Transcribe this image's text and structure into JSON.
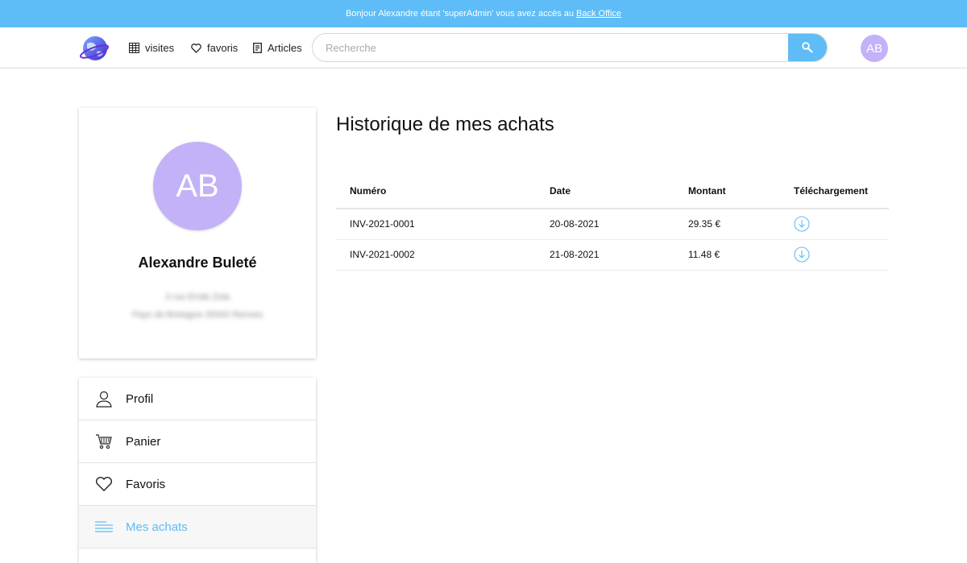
{
  "banner": {
    "text": "Bonjour Alexandre étant 'superAdmin' vous avez accès au",
    "link": "Back Office"
  },
  "header": {
    "nav": [
      {
        "label": "visites",
        "icon": "calendar-grid-icon"
      },
      {
        "label": "favoris",
        "icon": "heart-icon"
      },
      {
        "label": "Articles",
        "icon": "document-icon"
      }
    ],
    "search": {
      "placeholder": "Recherche",
      "value": ""
    },
    "avatar_initials": "AB"
  },
  "profile": {
    "initials": "AB",
    "name": "Alexandre Buleté",
    "address_line1": "3 rue Emile Zola",
    "address_line2": "Pays de Bretagne 35000 Rennes"
  },
  "menu": {
    "items": [
      {
        "label": "Profil",
        "icon": "user-icon",
        "active": false
      },
      {
        "label": "Panier",
        "icon": "cart-icon",
        "active": false
      },
      {
        "label": "Favoris",
        "icon": "heart-icon",
        "active": false
      },
      {
        "label": "Mes achats",
        "icon": "list-icon",
        "active": true
      }
    ]
  },
  "main": {
    "title": "Historique de mes achats",
    "table": {
      "headers": [
        "Numéro",
        "Date",
        "Montant",
        "Téléchargement"
      ],
      "rows": [
        {
          "number": "INV-2021-0001",
          "date": "20-08-2021",
          "amount": "29.35 €"
        },
        {
          "number": "INV-2021-0002",
          "date": "21-08-2021",
          "amount": "11.48 €"
        }
      ]
    }
  },
  "colors": {
    "accent": "#5ebcf6",
    "avatar": "#c3b2f7"
  }
}
